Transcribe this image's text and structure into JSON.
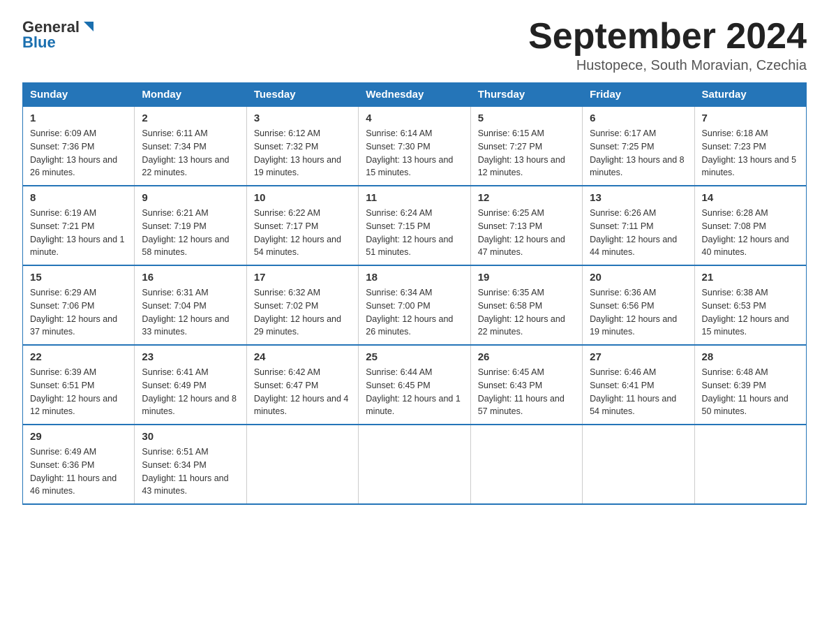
{
  "header": {
    "logo_line1": "General",
    "logo_line2": "Blue",
    "month_title": "September 2024",
    "location": "Hustopece, South Moravian, Czechia"
  },
  "days_of_week": [
    "Sunday",
    "Monday",
    "Tuesday",
    "Wednesday",
    "Thursday",
    "Friday",
    "Saturday"
  ],
  "weeks": [
    [
      {
        "day": "1",
        "sunrise": "6:09 AM",
        "sunset": "7:36 PM",
        "daylight": "13 hours and 26 minutes."
      },
      {
        "day": "2",
        "sunrise": "6:11 AM",
        "sunset": "7:34 PM",
        "daylight": "13 hours and 22 minutes."
      },
      {
        "day": "3",
        "sunrise": "6:12 AM",
        "sunset": "7:32 PM",
        "daylight": "13 hours and 19 minutes."
      },
      {
        "day": "4",
        "sunrise": "6:14 AM",
        "sunset": "7:30 PM",
        "daylight": "13 hours and 15 minutes."
      },
      {
        "day": "5",
        "sunrise": "6:15 AM",
        "sunset": "7:27 PM",
        "daylight": "13 hours and 12 minutes."
      },
      {
        "day": "6",
        "sunrise": "6:17 AM",
        "sunset": "7:25 PM",
        "daylight": "13 hours and 8 minutes."
      },
      {
        "day": "7",
        "sunrise": "6:18 AM",
        "sunset": "7:23 PM",
        "daylight": "13 hours and 5 minutes."
      }
    ],
    [
      {
        "day": "8",
        "sunrise": "6:19 AM",
        "sunset": "7:21 PM",
        "daylight": "13 hours and 1 minute."
      },
      {
        "day": "9",
        "sunrise": "6:21 AM",
        "sunset": "7:19 PM",
        "daylight": "12 hours and 58 minutes."
      },
      {
        "day": "10",
        "sunrise": "6:22 AM",
        "sunset": "7:17 PM",
        "daylight": "12 hours and 54 minutes."
      },
      {
        "day": "11",
        "sunrise": "6:24 AM",
        "sunset": "7:15 PM",
        "daylight": "12 hours and 51 minutes."
      },
      {
        "day": "12",
        "sunrise": "6:25 AM",
        "sunset": "7:13 PM",
        "daylight": "12 hours and 47 minutes."
      },
      {
        "day": "13",
        "sunrise": "6:26 AM",
        "sunset": "7:11 PM",
        "daylight": "12 hours and 44 minutes."
      },
      {
        "day": "14",
        "sunrise": "6:28 AM",
        "sunset": "7:08 PM",
        "daylight": "12 hours and 40 minutes."
      }
    ],
    [
      {
        "day": "15",
        "sunrise": "6:29 AM",
        "sunset": "7:06 PM",
        "daylight": "12 hours and 37 minutes."
      },
      {
        "day": "16",
        "sunrise": "6:31 AM",
        "sunset": "7:04 PM",
        "daylight": "12 hours and 33 minutes."
      },
      {
        "day": "17",
        "sunrise": "6:32 AM",
        "sunset": "7:02 PM",
        "daylight": "12 hours and 29 minutes."
      },
      {
        "day": "18",
        "sunrise": "6:34 AM",
        "sunset": "7:00 PM",
        "daylight": "12 hours and 26 minutes."
      },
      {
        "day": "19",
        "sunrise": "6:35 AM",
        "sunset": "6:58 PM",
        "daylight": "12 hours and 22 minutes."
      },
      {
        "day": "20",
        "sunrise": "6:36 AM",
        "sunset": "6:56 PM",
        "daylight": "12 hours and 19 minutes."
      },
      {
        "day": "21",
        "sunrise": "6:38 AM",
        "sunset": "6:53 PM",
        "daylight": "12 hours and 15 minutes."
      }
    ],
    [
      {
        "day": "22",
        "sunrise": "6:39 AM",
        "sunset": "6:51 PM",
        "daylight": "12 hours and 12 minutes."
      },
      {
        "day": "23",
        "sunrise": "6:41 AM",
        "sunset": "6:49 PM",
        "daylight": "12 hours and 8 minutes."
      },
      {
        "day": "24",
        "sunrise": "6:42 AM",
        "sunset": "6:47 PM",
        "daylight": "12 hours and 4 minutes."
      },
      {
        "day": "25",
        "sunrise": "6:44 AM",
        "sunset": "6:45 PM",
        "daylight": "12 hours and 1 minute."
      },
      {
        "day": "26",
        "sunrise": "6:45 AM",
        "sunset": "6:43 PM",
        "daylight": "11 hours and 57 minutes."
      },
      {
        "day": "27",
        "sunrise": "6:46 AM",
        "sunset": "6:41 PM",
        "daylight": "11 hours and 54 minutes."
      },
      {
        "day": "28",
        "sunrise": "6:48 AM",
        "sunset": "6:39 PM",
        "daylight": "11 hours and 50 minutes."
      }
    ],
    [
      {
        "day": "29",
        "sunrise": "6:49 AM",
        "sunset": "6:36 PM",
        "daylight": "11 hours and 46 minutes."
      },
      {
        "day": "30",
        "sunrise": "6:51 AM",
        "sunset": "6:34 PM",
        "daylight": "11 hours and 43 minutes."
      },
      null,
      null,
      null,
      null,
      null
    ]
  ]
}
